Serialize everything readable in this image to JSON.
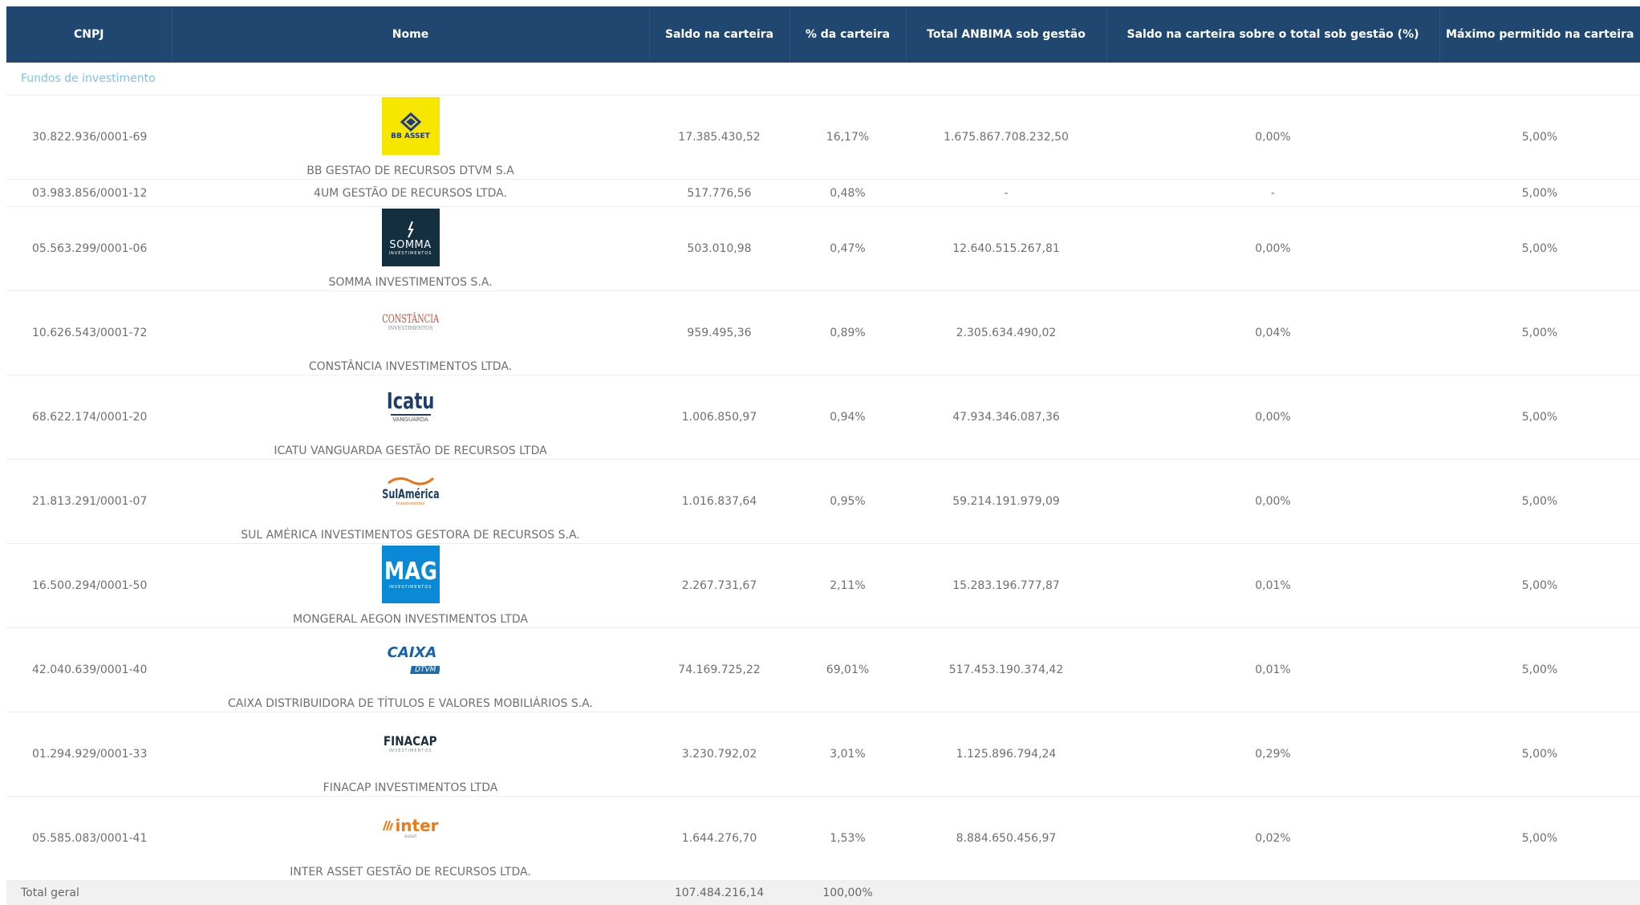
{
  "headers": {
    "cnpj": "CNPJ",
    "nome": "Nome",
    "saldo": "Saldo na carteira",
    "pct": "% da carteira",
    "total": "Total ANBIMA sob gestão",
    "saldo_total": "Saldo na carteira sobre o total sob gestão (%)",
    "maximo": "Máximo permitido na carteira"
  },
  "section_label": "Fundos de investimento",
  "rows": [
    {
      "cnpj": "30.822.936/0001-69",
      "logo": "BB ASSET",
      "logo_sub": "",
      "nome": "BB GESTAO DE RECURSOS DTVM S.A",
      "saldo": "17.385.430,52",
      "pct": "16,17%",
      "total": "1.675.867.708.232,50",
      "saldo_total": "0,00%",
      "maximo": "5,00%"
    },
    {
      "cnpj": "03.983.856/0001-12",
      "nome": "4UM GESTÃO DE RECURSOS LTDA.",
      "saldo": "517.776,56",
      "pct": "0,48%",
      "total": "-",
      "saldo_total": "-",
      "maximo": "5,00%"
    },
    {
      "cnpj": "05.563.299/0001-06",
      "logo": "SOMMA",
      "logo_sub": "INVESTIMENTOS",
      "nome": "SOMMA INVESTIMENTOS S.A.",
      "saldo": "503.010,98",
      "pct": "0,47%",
      "total": "12.640.515.267,81",
      "saldo_total": "0,00%",
      "maximo": "5,00%"
    },
    {
      "cnpj": "10.626.543/0001-72",
      "logo": "CONSTÂNCIA",
      "logo_sub": "INVESTIMENTOS",
      "nome": "CONSTÂNCIA INVESTIMENTOS LTDA.",
      "saldo": "959.495,36",
      "pct": "0,89%",
      "total": "2.305.634.490,02",
      "saldo_total": "0,04%",
      "maximo": "5,00%"
    },
    {
      "cnpj": "68.622.174/0001-20",
      "logo": "Icatu",
      "logo_sub": "VANGUARDA",
      "nome": "ICATU VANGUARDA GESTÃO DE RECURSOS LTDA",
      "saldo": "1.006.850,97",
      "pct": "0,94%",
      "total": "47.934.346.087,36",
      "saldo_total": "0,00%",
      "maximo": "5,00%"
    },
    {
      "cnpj": "21.813.291/0001-07",
      "logo": "SulAmérica",
      "logo_sub": "Investimentos",
      "nome": "SUL AMÉRICA INVESTIMENTOS GESTORA DE RECURSOS S.A.",
      "saldo": "1.016.837,64",
      "pct": "0,95%",
      "total": "59.214.191.979,09",
      "saldo_total": "0,00%",
      "maximo": "5,00%"
    },
    {
      "cnpj": "16.500.294/0001-50",
      "logo": "MAG",
      "logo_sub": "INVESTIMENTOS",
      "nome": "MONGERAL AEGON INVESTIMENTOS LTDA",
      "saldo": "2.267.731,67",
      "pct": "2,11%",
      "total": "15.283.196.777,87",
      "saldo_total": "0,01%",
      "maximo": "5,00%"
    },
    {
      "cnpj": "42.040.639/0001-40",
      "logo": "CAIXA",
      "logo_sub": "DTVM",
      "nome": "CAIXA DISTRIBUIDORA DE TÍTULOS E VALORES MOBILIÁRIOS S.A.",
      "saldo": "74.169.725,22",
      "pct": "69,01%",
      "total": "517.453.190.374,42",
      "saldo_total": "0,01%",
      "maximo": "5,00%"
    },
    {
      "cnpj": "01.294.929/0001-33",
      "logo": "FINACAP",
      "logo_sub": "INVESTIMENTOS",
      "nome": "FINACAP INVESTIMENTOS LTDA",
      "saldo": "3.230.792,02",
      "pct": "3,01%",
      "total": "1.125.896.794,24",
      "saldo_total": "0,29%",
      "maximo": "5,00%"
    },
    {
      "cnpj": "05.585.083/0001-41",
      "logo": "inter",
      "logo_sub": "asset",
      "nome": "INTER ASSET GESTÃO DE RECURSOS LTDA.",
      "saldo": "1.644.276,70",
      "pct": "1,53%",
      "total": "8.884.650.456,97",
      "saldo_total": "0,02%",
      "maximo": "5,00%"
    }
  ],
  "total": {
    "label": "Total geral",
    "saldo": "107.484.216,14",
    "pct": "100,00%"
  }
}
